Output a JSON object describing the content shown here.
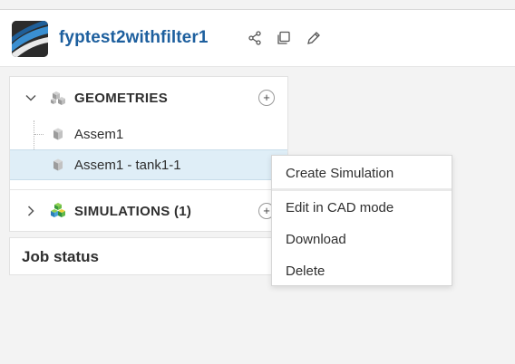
{
  "header": {
    "project_title": "fyptest2withfilter1",
    "icons": [
      "share-icon",
      "copy-icon",
      "edit-icon"
    ]
  },
  "tree": {
    "geometries": {
      "label": "GEOMETRIES",
      "expanded": true,
      "items": [
        {
          "label": "Assem1",
          "selected": false
        },
        {
          "label": "Assem1 - tank1-1",
          "selected": true
        }
      ]
    },
    "simulations": {
      "label": "SIMULATIONS (1)",
      "expanded": false
    }
  },
  "job_status": {
    "label": "Job status"
  },
  "context_menu": {
    "items": [
      "Create Simulation",
      "Edit in CAD mode",
      "Download",
      "Delete"
    ]
  },
  "colors": {
    "title": "#1d5f9e",
    "selected_row": "#dfeef7",
    "background": "#f3f3f3"
  }
}
